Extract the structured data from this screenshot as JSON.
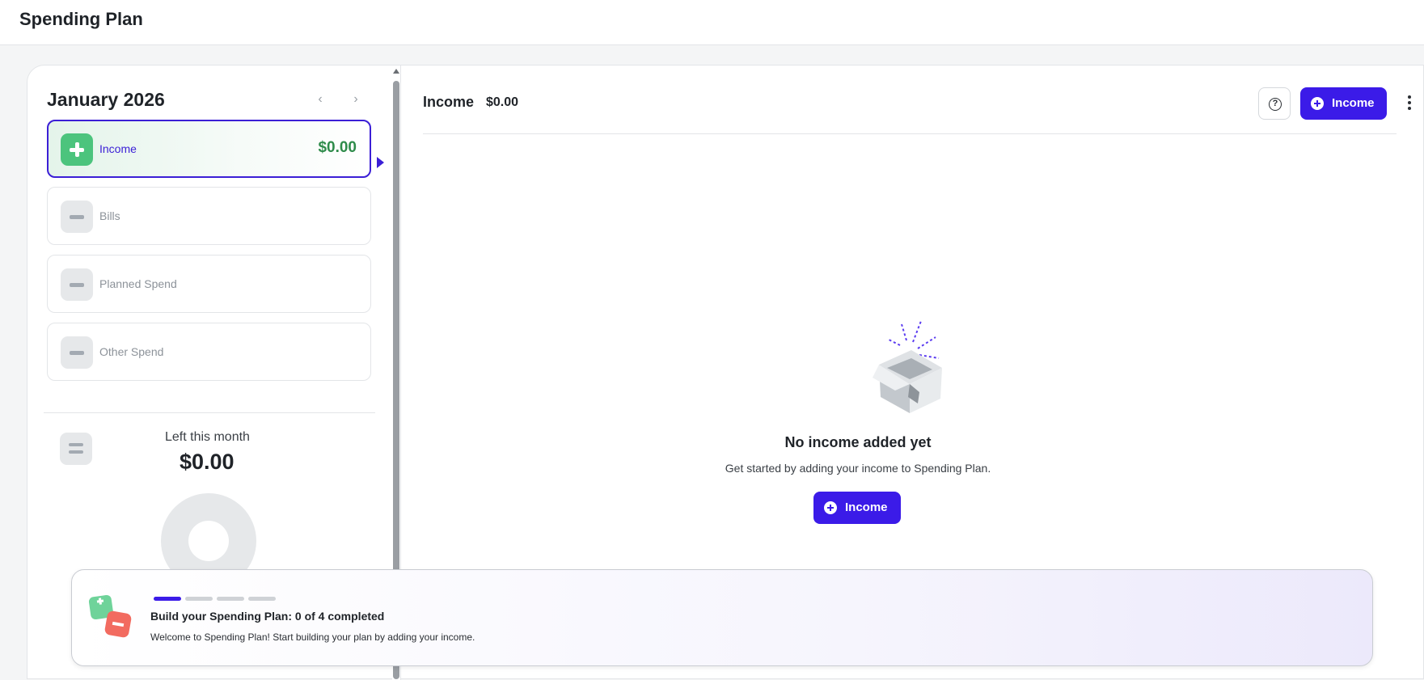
{
  "header": {
    "title": "Spending Plan"
  },
  "period": {
    "title": "January 2026",
    "prev_icon": "chevron-left-icon",
    "next_icon": "chevron-right-icon"
  },
  "categories": [
    {
      "label": "Income",
      "amount": "$0.00",
      "active": true,
      "icon": "plus-icon"
    },
    {
      "label": "Bills",
      "amount": "",
      "active": false,
      "icon": "minus-icon"
    },
    {
      "label": "Planned Spend",
      "amount": "",
      "active": false,
      "icon": "minus-icon"
    },
    {
      "label": "Other Spend",
      "amount": "",
      "active": false,
      "icon": "minus-icon"
    }
  ],
  "summary": {
    "caption": "Left this month",
    "amount": "$0.00",
    "icon": "equals-icon"
  },
  "income_panel": {
    "title": "Income",
    "total": "$0.00",
    "add_button_label": "Income",
    "help_icon": "help-circle-icon",
    "more_icon": "kebab-menu-icon"
  },
  "empty_state": {
    "title": "No income added yet",
    "subtitle": "Get started by adding your income to Spending Plan.",
    "button_label": "Income"
  },
  "onboarding": {
    "title": "Build your Spending Plan: 0 of 4 completed",
    "subtitle": "Welcome to Spending Plan! Start building your plan by adding your income.",
    "completed": 0,
    "total": 4
  },
  "colors": {
    "accent": "#3b1be8",
    "income_green": "#4cc47d",
    "income_amount": "#2e8b4a"
  }
}
